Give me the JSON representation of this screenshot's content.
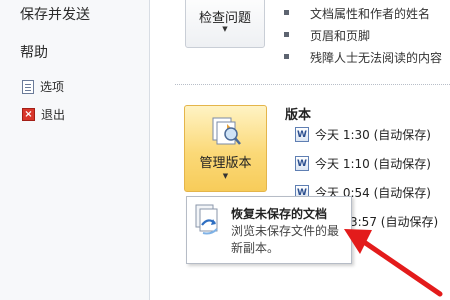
{
  "nav": {
    "share": "保存并发送",
    "help": "帮助",
    "options": "选项",
    "exit": "退出"
  },
  "inspect": {
    "button_label": "检查问题"
  },
  "bullets": [
    "文档属性和作者的姓名",
    "页眉和页脚",
    "残障人士无法阅读的内容"
  ],
  "manage": {
    "button_label": "管理版本"
  },
  "versions": {
    "title": "版本",
    "items": [
      {
        "time": "今天 1:30 (自动保存)"
      },
      {
        "time": "今天 1:10 (自动保存)"
      },
      {
        "time": "今天 0:54 (自动保存)"
      },
      {
        "time": "3:57 (自动保存)"
      }
    ]
  },
  "menu": {
    "recover_title": "恢复未保存的文档",
    "recover_desc": "浏览未保存文件的最新副本。"
  },
  "colors": {
    "accent_yellow": "#fbd978",
    "arrow_red": "#e31b1b"
  }
}
